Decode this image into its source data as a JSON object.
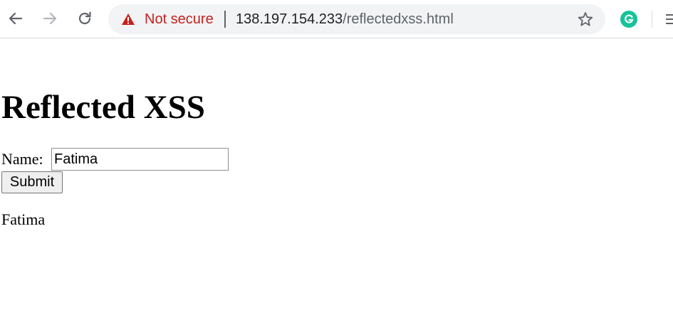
{
  "browser": {
    "security_label": "Not secure",
    "url_host": "138.197.154.233",
    "url_path": "/reflectedxss.html",
    "icons": {
      "back": "back-arrow-icon",
      "forward": "forward-arrow-icon",
      "reload": "reload-icon",
      "security": "warning-triangle-icon",
      "bookmark": "star-icon",
      "extension": "grammarly-icon",
      "menu": "menu-icon"
    },
    "colors": {
      "not_secure": "#c5221f",
      "omnibox_bg": "#f1f3f4",
      "extension": "#15c39a"
    }
  },
  "page": {
    "title": "Reflected XSS",
    "form": {
      "name_label": "Name:",
      "name_value": "Fatima",
      "submit_label": "Submit"
    },
    "output": "Fatima"
  }
}
